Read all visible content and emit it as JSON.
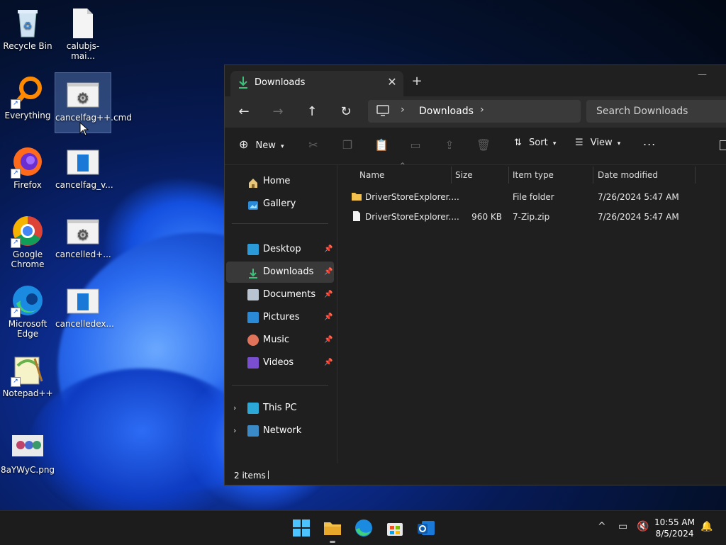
{
  "desktop": {
    "icons": [
      {
        "label": "Recycle Bin"
      },
      {
        "label": "calubjs-mai..."
      },
      {
        "label": "Everything"
      },
      {
        "label": "cancelfag++.cmd"
      },
      {
        "label": "Firefox"
      },
      {
        "label": "cancelfag_v..."
      },
      {
        "label": "Google Chrome"
      },
      {
        "label": "cancelled+..."
      },
      {
        "label": "Microsoft Edge"
      },
      {
        "label": "cancelledex..."
      },
      {
        "label": "Notepad++"
      },
      {
        "label": "8aYWyC.png"
      }
    ]
  },
  "explorer": {
    "tab_title": "Downloads",
    "new_tab": "+",
    "address": {
      "location": "Downloads"
    },
    "search": {
      "placeholder": "Search Downloads"
    },
    "toolbar": {
      "new_label": "New",
      "sort_label": "Sort",
      "view_label": "View",
      "more": "..."
    },
    "sidebar": {
      "items": [
        {
          "label": "Home"
        },
        {
          "label": "Gallery"
        },
        {
          "label": "Desktop"
        },
        {
          "label": "Downloads"
        },
        {
          "label": "Documents"
        },
        {
          "label": "Pictures"
        },
        {
          "label": "Music"
        },
        {
          "label": "Videos"
        },
        {
          "label": "This PC"
        },
        {
          "label": "Network"
        }
      ]
    },
    "columns": {
      "name": "Name",
      "size": "Size",
      "type": "Item type",
      "date": "Date modified"
    },
    "files": [
      {
        "name": "DriverStoreExplorer....",
        "size": "",
        "type": "File folder",
        "date": "7/26/2024 5:47 AM"
      },
      {
        "name": "DriverStoreExplorer....",
        "size": "960 KB",
        "type": "7-Zip.zip",
        "date": "7/26/2024 5:47 AM"
      }
    ],
    "status": {
      "count": "2 items"
    }
  },
  "taskbar": {
    "time": "10:55 AM",
    "date": "8/5/2024"
  }
}
